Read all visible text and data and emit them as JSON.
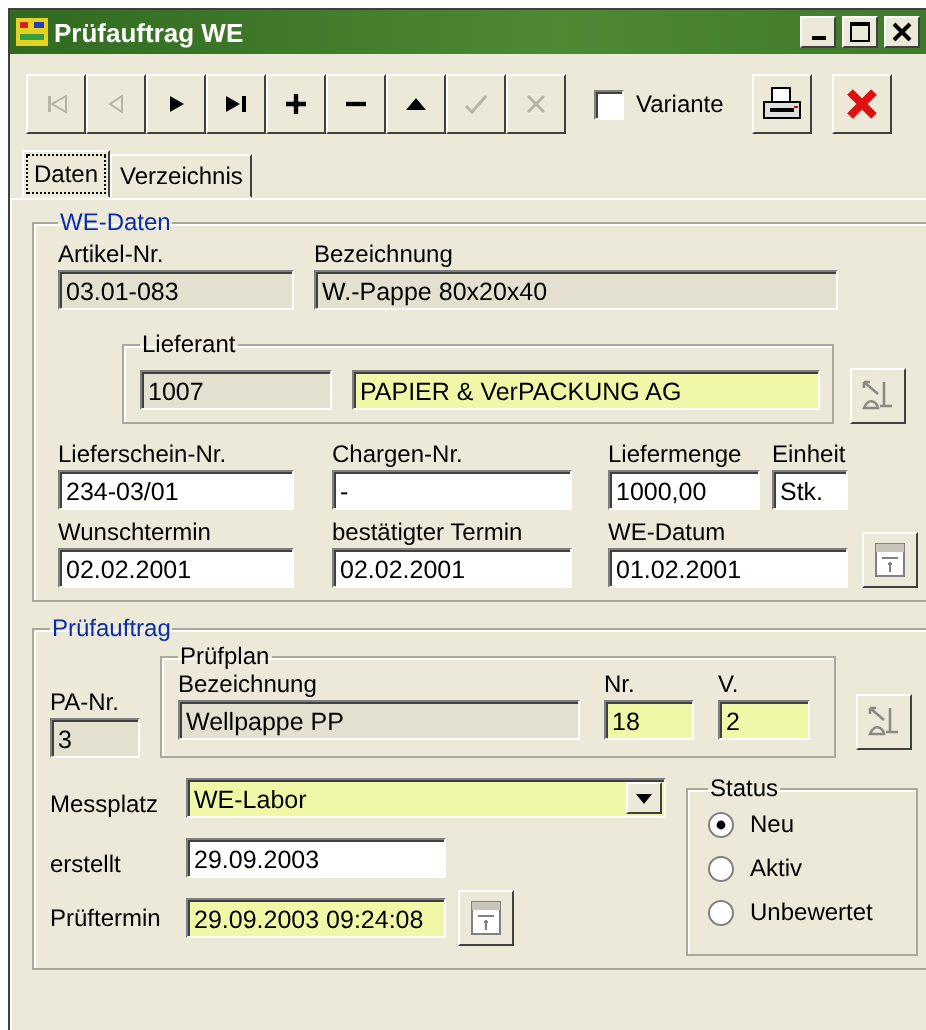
{
  "window": {
    "title": "Prüfauftrag WE"
  },
  "toolbar": {
    "buttons": [
      {
        "kind": "first",
        "disabled": true
      },
      {
        "kind": "prev",
        "disabled": true
      },
      {
        "kind": "next",
        "disabled": false
      },
      {
        "kind": "last",
        "disabled": false
      },
      {
        "kind": "add",
        "disabled": false
      },
      {
        "kind": "remove",
        "disabled": false
      },
      {
        "kind": "up",
        "disabled": false
      },
      {
        "kind": "confirm",
        "disabled": true
      },
      {
        "kind": "cancel",
        "disabled": true
      }
    ],
    "variante": {
      "label": "Variante",
      "checked": false
    }
  },
  "tabs": [
    {
      "label": "Daten",
      "selected": true
    },
    {
      "label": "Verzeichnis",
      "selected": false
    }
  ],
  "we_daten": {
    "title": "WE-Daten",
    "artikel_nr": {
      "label": "Artikel-Nr.",
      "value": "03.01-083",
      "kind": "readonly"
    },
    "bezeichnung": {
      "label": "Bezeichnung",
      "value": "W.-Pappe 80x20x40",
      "kind": "readonly"
    },
    "lieferant": {
      "title": "Lieferant",
      "nummer": {
        "value": "1007",
        "kind": "readonly"
      },
      "name": {
        "value": "PAPIER & VerPACKUNG AG",
        "kind": "highlight"
      }
    },
    "row_1": [
      {
        "label": "Lieferschein-Nr.",
        "value": "234-03/01",
        "kind": "input"
      },
      {
        "label": "Chargen-Nr.",
        "value": "-",
        "kind": "input"
      },
      {
        "label": "Liefermenge",
        "value": "1000,00",
        "kind": "input"
      },
      {
        "label": "Einheit",
        "value": "Stk.",
        "kind": "input"
      }
    ],
    "row_2": [
      {
        "label": "Wunschtermin",
        "value": "02.02.2001",
        "kind": "input"
      },
      {
        "label": "bestätigter Termin",
        "value": "02.02.2001",
        "kind": "input"
      },
      {
        "label": "WE-Datum",
        "value": "01.02.2001",
        "kind": "input"
      }
    ]
  },
  "pruefauftrag": {
    "title": "Prüfauftrag",
    "pa_nr": {
      "label": "PA-Nr.",
      "value": "3",
      "kind": "readonly"
    },
    "pruefplan": {
      "title": "Prüfplan",
      "bezeichnung": {
        "label": "Bezeichnung",
        "value": "Wellpappe PP",
        "kind": "readonly"
      },
      "nr": {
        "label": "Nr.",
        "value": "18",
        "kind": "highlight"
      },
      "v": {
        "label": "V.",
        "value": "2",
        "kind": "highlight"
      }
    },
    "messplatz": {
      "label": "Messplatz",
      "value": "WE-Labor",
      "kind": "highlight"
    },
    "erstellt": {
      "label": "erstellt",
      "value": "29.09.2003",
      "kind": "input"
    },
    "prueftermin": {
      "label": "Prüftermin",
      "value": "29.09.2003 09:24:08",
      "kind": "highlight"
    },
    "status": {
      "title": "Status",
      "options": [
        {
          "label": "Neu",
          "selected": true
        },
        {
          "label": "Aktiv",
          "selected": false
        },
        {
          "label": "Unbewertet",
          "selected": false
        }
      ]
    }
  }
}
